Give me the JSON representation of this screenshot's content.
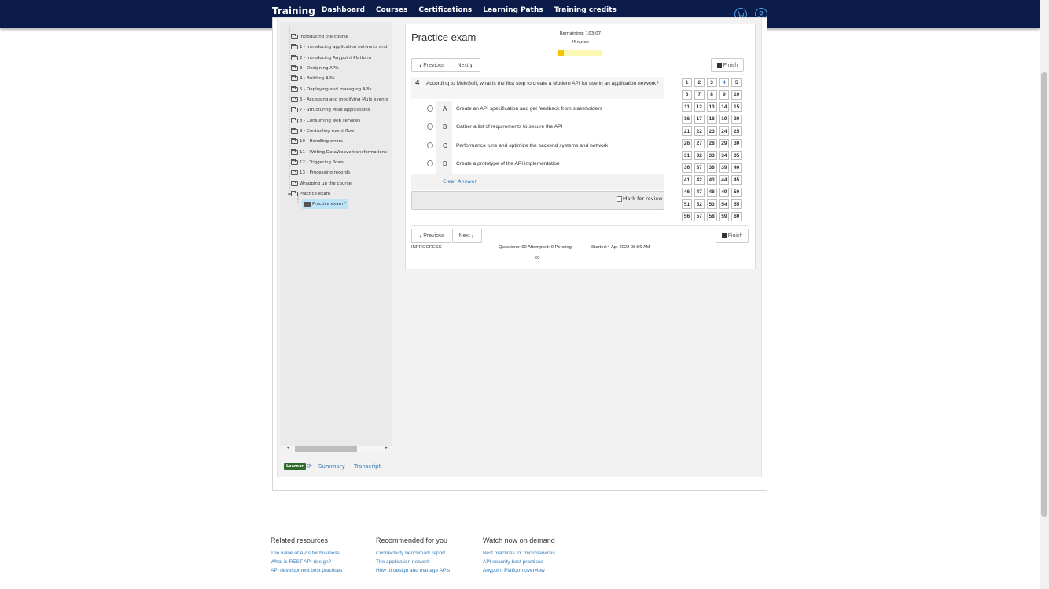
{
  "header": {
    "brand": "Training",
    "nav": [
      "Dashboard",
      "Courses",
      "Certifications",
      "Learning Paths",
      "Training credits"
    ],
    "icons": [
      "cart-icon",
      "user-icon"
    ]
  },
  "tree": {
    "items": [
      "Introducing the course",
      "1 - Introducing application networks and",
      "2 - Introducing Anypoint Platform",
      "3 - Designing APIs",
      "4 - Building APIs",
      "5 - Deploying and managing APIs",
      "6 - Accessing and modifying Mule events",
      "7 - Structuring Mule applications",
      "8 - Consuming web services",
      "9 - Controlling event flow",
      "10 - Handling errors",
      "11 - Writing DataWeave transformations",
      "12 - Triggering flows",
      "13 - Processing records",
      "Wrapping up the course",
      "Practice exam"
    ],
    "selected": "Practice exam *"
  },
  "bottom_bar": {
    "badge": "Learner",
    "summary": "Summary",
    "transcript": "Transcript"
  },
  "exam": {
    "title": "Practice exam",
    "remaining_line1": "Remaining: 103:07",
    "remaining_line2": "Minutes",
    "progress_fraction": 0.14,
    "previous": "Previous",
    "next": "Next",
    "finish": "Finish",
    "question_number": "4",
    "question_text": "According to MuleSoft, what is the first step to create a Modern API for use in an application network?",
    "options": [
      {
        "letter": "A",
        "text": "Create an API specification and get feedback from stakeholders"
      },
      {
        "letter": "B",
        "text": "Gather a list of requirements to secure the API"
      },
      {
        "letter": "C",
        "text": "Performance tune and optimize the backend systems and network"
      },
      {
        "letter": "D",
        "text": "Create a prototype of the API implementation"
      }
    ],
    "clear_answer": "Clear Answer",
    "mark_for_review": "Mark for review",
    "current_question": 4,
    "total_questions": 60,
    "status": "INPROGRESS",
    "counts_line1": "Questions: 60 Attempted: 0 Pending:",
    "counts_line2": "60",
    "started": "Started:4 Apr 2022 08:56 AM"
  },
  "footer": {
    "columns": [
      {
        "heading": "Related resources",
        "links": [
          "The value of APIs for business",
          "What is REST API design?",
          "API development best practices"
        ]
      },
      {
        "heading": "Recommended for you",
        "links": [
          "Connectivity benchmark report",
          "The application network",
          "How to design and manage APIs"
        ]
      },
      {
        "heading": "Watch now on demand",
        "links": [
          "Best practices for microservices",
          "API security best practices",
          "Anypoint Platform overview"
        ]
      }
    ]
  },
  "colors": {
    "nav_bg": "#0b1b4a",
    "link": "#337ab7",
    "progress": "#f5c400",
    "learner_badge": "#2d6b2d"
  }
}
